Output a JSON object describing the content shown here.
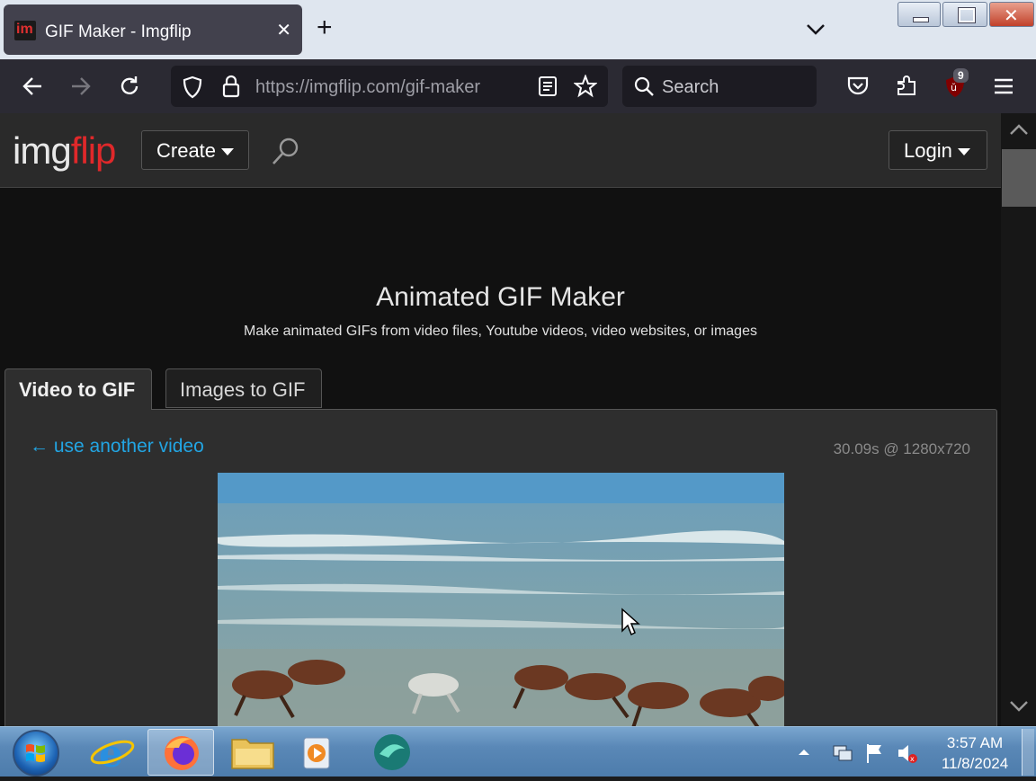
{
  "browser": {
    "tab_title": "GIF Maker - Imgflip",
    "url_host": "https://imgflip.com",
    "url_path": "/gif-maker",
    "search_placeholder": "Search",
    "extension_badge": "9"
  },
  "site": {
    "logo_img": "img",
    "logo_flip": "flip",
    "create_label": "Create",
    "login_label": "Login"
  },
  "hero": {
    "title": "Animated GIF Maker",
    "subtitle": "Make animated GIFs from video files, Youtube videos, video websites, or images"
  },
  "tabs": {
    "video_to_gif": "Video to GIF",
    "images_to_gif": "Images to GIF"
  },
  "panel": {
    "another_video": "← use another video",
    "video_meta": "30.09s @ 1280x720"
  },
  "taskbar": {
    "time": "3:57 AM",
    "date": "11/8/2024"
  },
  "colors": {
    "accent_link": "#22a5e3",
    "logo_red": "#e0282a"
  }
}
